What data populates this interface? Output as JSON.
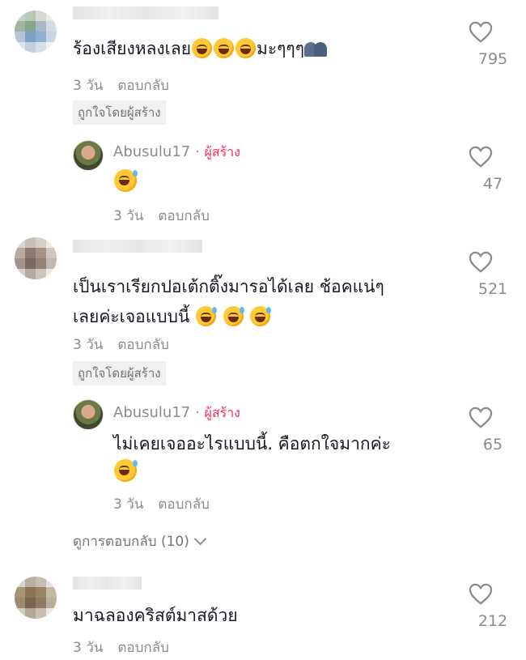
{
  "comments": [
    {
      "text": "ร้องเสียงหลงเลย",
      "text_suffix": "มะๆๆๆ",
      "time": "3 วัน",
      "reply_label": "ตอบกลับ",
      "liked_by_creator": "ถูกใจโดยผู้สร้าง",
      "likes": "795",
      "reply": {
        "username": "Abusulu17",
        "dot": "·",
        "creator_label": "ผู้สร้าง",
        "time": "3 วัน",
        "reply_label": "ตอบกลับ",
        "likes": "47"
      }
    },
    {
      "text_line1": "เป็นเราเรียกปอเต้กติ๊งมารอได้เลย ช้อคแน่ๆ",
      "text_line2": "เลยค่ะเจอแบบนี้",
      "time": "3 วัน",
      "reply_label": "ตอบกลับ",
      "liked_by_creator": "ถูกใจโดยผู้สร้าง",
      "likes": "521",
      "reply": {
        "username": "Abusulu17",
        "dot": "·",
        "creator_label": "ผู้สร้าง",
        "text": "ไม่เคยเจออะไรแบบนี้. คือตกใจมากค่ะ",
        "time": "3 วัน",
        "reply_label": "ตอบกลับ",
        "likes": "65"
      },
      "view_replies": "ดูการตอบกลับ (10)"
    },
    {
      "text": "มาฉลองคริสต์มาสด้วย",
      "time": "3 วัน",
      "reply_label": "ตอบกลับ",
      "likes": "212"
    }
  ],
  "colors": {
    "creator": "#fe2c55",
    "muted": "#8a8b91",
    "text": "#161823"
  }
}
